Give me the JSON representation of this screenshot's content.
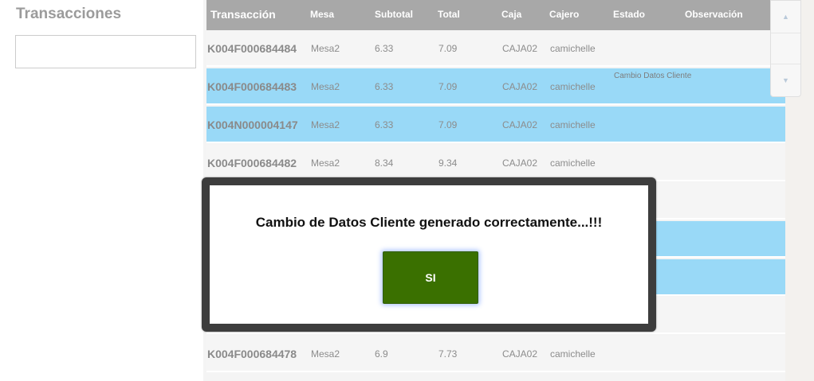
{
  "left": {
    "title": "Transacciones",
    "search_value": ""
  },
  "table": {
    "headers": [
      "Transacción",
      "Mesa",
      "Subtotal",
      "Total",
      "Caja",
      "Cajero",
      "Estado",
      "Observación"
    ],
    "rows": [
      {
        "trans": "K004F000684484",
        "mesa": "Mesa2",
        "sub": "6.33",
        "tot": "7.09",
        "caja": "CAJA02",
        "cajero": "camichelle",
        "obs": "",
        "selected": false
      },
      {
        "trans": "K004F000684483",
        "mesa": "Mesa2",
        "sub": "6.33",
        "tot": "7.09",
        "caja": "CAJA02",
        "cajero": "camichelle",
        "obs": "Cambio Datos Cliente",
        "selected": true
      },
      {
        "trans": "K004N000004147",
        "mesa": "Mesa2",
        "sub": "6.33",
        "tot": "7.09",
        "caja": "CAJA02",
        "cajero": "camichelle",
        "obs": "",
        "selected": true
      },
      {
        "trans": "K004F000684482",
        "mesa": "Mesa2",
        "sub": "8.34",
        "tot": "9.34",
        "caja": "CAJA02",
        "cajero": "camichelle",
        "obs": "",
        "selected": false
      },
      {
        "trans": "",
        "mesa": "",
        "sub": "",
        "tot": "",
        "caja": "",
        "cajero": "",
        "obs": "",
        "selected": false
      },
      {
        "trans": "",
        "mesa": "",
        "sub": "",
        "tot": "",
        "caja": "",
        "cajero": "",
        "obs": "",
        "selected": true
      },
      {
        "trans": "",
        "mesa": "",
        "sub": "",
        "tot": "",
        "caja": "",
        "cajero": "",
        "obs": "",
        "selected": true
      },
      {
        "trans": "",
        "mesa": "",
        "sub": "",
        "tot": "",
        "caja": "",
        "cajero": "",
        "obs": "",
        "selected": false
      },
      {
        "trans": "K004F000684478",
        "mesa": "Mesa2",
        "sub": "6.9",
        "tot": "7.73",
        "caja": "CAJA02",
        "cajero": "camichelle",
        "obs": "",
        "selected": false
      }
    ]
  },
  "scroll": {
    "up_icon": "chevron-up-icon",
    "down_icon": "chevron-down-icon"
  },
  "modal": {
    "message": "Cambio de Datos Cliente generado correctamente...!!!",
    "confirm_label": "SI"
  },
  "colors": {
    "header_bg": "#a8a8a8",
    "selected_row": "#99d9f7",
    "confirm_button": "#3a7000",
    "modal_frame": "#3d3d3d"
  }
}
